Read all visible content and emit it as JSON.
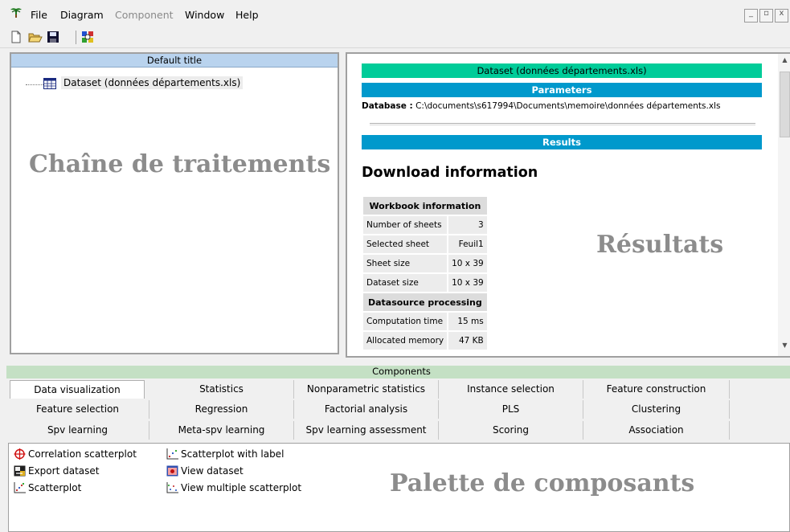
{
  "menu": {
    "items": [
      {
        "label": "File",
        "enabled": true
      },
      {
        "label": "Diagram",
        "enabled": true
      },
      {
        "label": "Component",
        "enabled": false
      },
      {
        "label": "Window",
        "enabled": true
      },
      {
        "label": "Help",
        "enabled": true
      }
    ]
  },
  "window_buttons": {
    "minimize": "_",
    "restore": "▫",
    "close": "x"
  },
  "toolbar": {
    "icons": [
      "new-file-icon",
      "open-folder-icon",
      "save-icon",
      "execute-icon"
    ]
  },
  "left_panel": {
    "title": "Default title",
    "tree_node": "Dataset (données départements.xls)",
    "watermark": "Chaîne de traitements"
  },
  "right_panel": {
    "dataset_bar": "Dataset (données départements.xls)",
    "parameters_bar": "Parameters",
    "database_label": "Database :",
    "database_path": "C:\\documents\\s617994\\Documents\\memoire\\données départements.xls",
    "results_bar": "Results",
    "download_title": "Download information",
    "watermark": "Résultats",
    "workbook_header": "Workbook information",
    "workbook_rows": [
      {
        "label": "Number of sheets",
        "value": "3"
      },
      {
        "label": "Selected sheet",
        "value": "Feuil1"
      },
      {
        "label": "Sheet size",
        "value": "10 x 39"
      },
      {
        "label": "Dataset size",
        "value": "10 x 39"
      }
    ],
    "datasource_header": "Datasource processing",
    "datasource_rows": [
      {
        "label": "Computation time",
        "value": "15 ms"
      },
      {
        "label": "Allocated memory",
        "value": "47 KB"
      }
    ]
  },
  "components": {
    "header": "Components",
    "tabs": [
      [
        "Data visualization",
        "Statistics",
        "Nonparametric statistics",
        "Instance selection",
        "Feature construction"
      ],
      [
        "Feature selection",
        "Regression",
        "Factorial analysis",
        "PLS",
        "Clustering"
      ],
      [
        "Spv learning",
        "Meta-spv learning",
        "Spv learning assessment",
        "Scoring",
        "Association"
      ]
    ],
    "active_tab": "Data visualization",
    "palette": [
      {
        "label": "Correlation scatterplot",
        "icon": "crosshair-icon"
      },
      {
        "label": "Export dataset",
        "icon": "export-icon"
      },
      {
        "label": "Scatterplot",
        "icon": "scatterplot-icon"
      },
      {
        "label": "Scatterplot with label",
        "icon": "scatterplot-label-icon"
      },
      {
        "label": "View dataset",
        "icon": "view-dataset-icon"
      },
      {
        "label": "View multiple scatterplot",
        "icon": "multiple-scatterplot-icon"
      }
    ],
    "watermark": "Palette de composants"
  }
}
